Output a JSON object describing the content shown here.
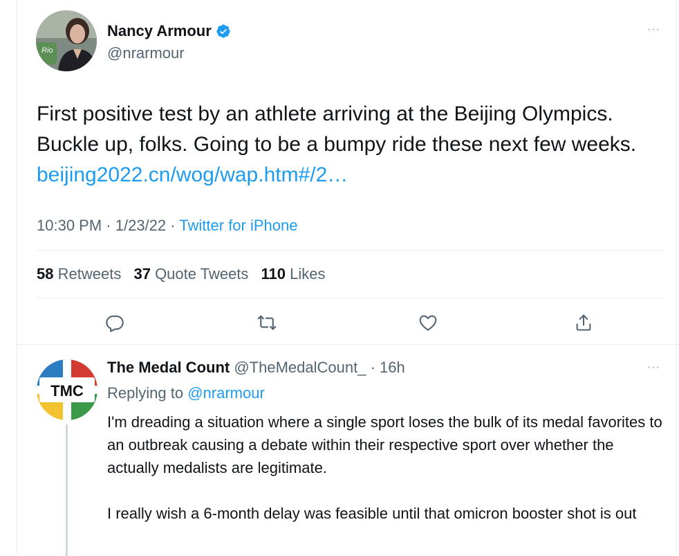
{
  "main_tweet": {
    "author_name": "Nancy Armour",
    "author_handle": "@nrarmour",
    "avatar_badge": "Rio",
    "more_label": "···",
    "text": "First positive test by an athlete arriving at the Beijing Olympics. Buckle up, folks. Going to be a bumpy ride these next few weeks.",
    "link": "beijing2022.cn/wog/wap.htm#/2…",
    "time": "10:30 PM",
    "date": "1/23/22",
    "source": "Twitter for iPhone",
    "separator": " · ",
    "stats": {
      "retweets_count": "58",
      "retweets_label": "Retweets",
      "quotes_count": "37",
      "quotes_label": "Quote Tweets",
      "likes_count": "110",
      "likes_label": "Likes"
    },
    "actions": [
      "reply-icon",
      "retweet-icon",
      "like-icon",
      "share-icon"
    ]
  },
  "reply": {
    "author_name": "The Medal Count",
    "author_handle": "@TheMedalCount_",
    "time_ago": "16h",
    "avatar_text": "TMC",
    "more_label": "···",
    "replying_label": "Replying to",
    "replying_to": "@nrarmour",
    "paragraphs": [
      "I'm dreading a situation where a single sport loses the bulk of its medal favorites to an outbreak causing a debate within their respective sport over whether the actually medalists are legitimate.",
      "I really wish a 6-month delay was feasible until that omicron booster shot is out"
    ]
  },
  "colors": {
    "accent": "#1d9bf0",
    "text": "#0f1419",
    "muted": "#536471",
    "divider": "#e6ecf0",
    "tmc_red": "#d43b30",
    "tmc_blue": "#2b7cc1",
    "tmc_yellow": "#f2c230",
    "tmc_green": "#3a9a49"
  }
}
